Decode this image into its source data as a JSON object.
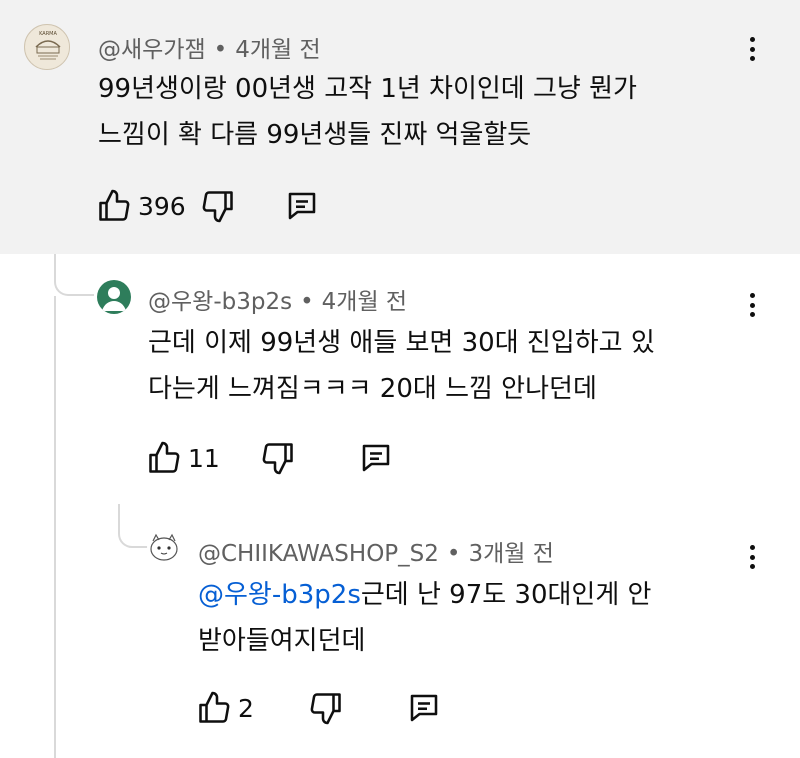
{
  "comments": [
    {
      "author": "@새우가잼",
      "time": "4개월 전",
      "text_lines": [
        "99년생이랑 00년생 고작 1년 차이인데 그냥 뭔가",
        "느낌이 확 다름 99년생들 진짜 억울할듯"
      ],
      "likes": "396",
      "avatar_text": "KARMA"
    },
    {
      "author": "@우왕-b3p2s",
      "time": "4개월 전",
      "text_lines": [
        "근데 이제 99년생 애들 보면 30대 진입하고 있",
        "다는게 느껴짐ㅋㅋㅋ 20대 느낌 안나던데"
      ],
      "likes": "11"
    },
    {
      "author": "@CHIIKAWASHOP_S2",
      "time": "3개월 전",
      "mention": "@우왕-b3p2s",
      "text_line1_rest": "근데 난 97도 30대인게 안",
      "text_line2": "받아들여지던데",
      "likes": "2"
    }
  ],
  "separator": "•",
  "colors": {
    "mention": "#065fd4",
    "top_bg": "#f2f2f2",
    "meta": "#606060"
  },
  "icons": [
    "thumbs-up-icon",
    "thumbs-down-icon",
    "reply-icon",
    "more-vert-icon"
  ]
}
